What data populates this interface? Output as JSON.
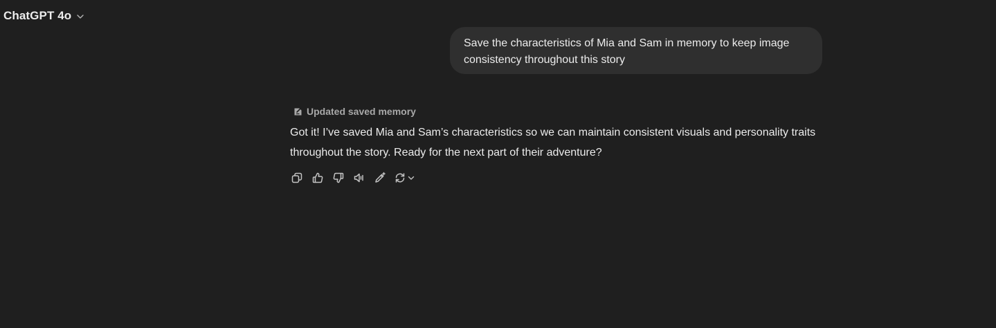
{
  "header": {
    "model_name": "ChatGPT 4o",
    "model_menu_icon": "chevron-down-icon"
  },
  "conversation": {
    "user_message": "Save the characteristics of Mia and Sam in memory to keep image consistency throughout this story",
    "memory_note": {
      "icon": "memory-icon",
      "label": "Updated saved memory"
    },
    "assistant_message": "Got it! I’ve saved Mia and Sam’s characteristics so we can maintain consistent visuals and personality traits throughout the story. Ready for the next part of their adventure?",
    "actions": [
      {
        "name": "copy",
        "icon": "copy-icon"
      },
      {
        "name": "good-response",
        "icon": "thumbs-up-icon"
      },
      {
        "name": "bad-response",
        "icon": "thumbs-down-icon"
      },
      {
        "name": "read-aloud",
        "icon": "speaker-icon"
      },
      {
        "name": "edit-in-canvas",
        "icon": "pencil-sparkle-icon"
      },
      {
        "name": "regenerate",
        "icon": "refresh-icon"
      }
    ]
  },
  "colors": {
    "background": "#1f1f1f",
    "bubble": "#2f2f2f",
    "text": "#ececec",
    "muted": "#a8a8a8",
    "icon": "#c4c4c4"
  }
}
